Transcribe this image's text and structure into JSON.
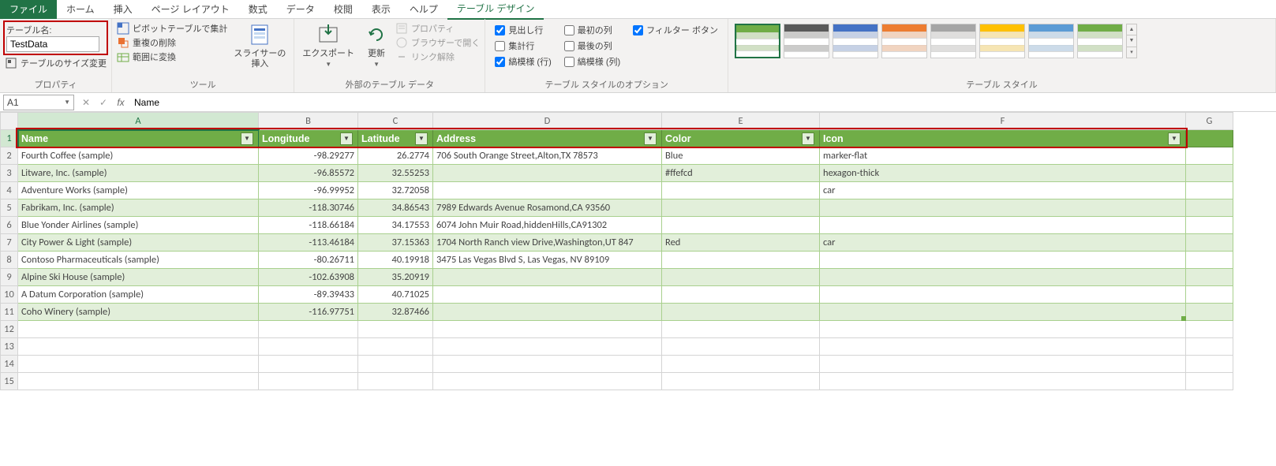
{
  "tabs": {
    "file": "ファイル",
    "home": "ホーム",
    "insert": "挿入",
    "pageLayout": "ページ レイアウト",
    "formulas": "数式",
    "data": "データ",
    "review": "校閲",
    "view": "表示",
    "help": "ヘルプ",
    "tableDesign": "テーブル デザイン"
  },
  "ribbon": {
    "props": {
      "label": "テーブル名:",
      "value": "TestData",
      "resize": "テーブルのサイズ変更",
      "group": "プロパティ"
    },
    "tools": {
      "pivot": "ピボットテーブルで集計",
      "dedup": "重複の削除",
      "range": "範囲に変換",
      "slicer": "スライサーの\n挿入",
      "group": "ツール"
    },
    "external": {
      "export": "エクスポート",
      "refresh": "更新",
      "properties": "プロパティ",
      "browser": "ブラウザーで開く",
      "unlink": "リンク解除",
      "group": "外部のテーブル データ"
    },
    "options": {
      "headerRow": "見出し行",
      "totalRow": "集計行",
      "bandedRows": "縞模様 (行)",
      "firstCol": "最初の列",
      "lastCol": "最後の列",
      "bandedCols": "縞模様 (列)",
      "filterBtn": "フィルター ボタン",
      "group": "テーブル スタイルのオプション"
    },
    "styles": {
      "group": "テーブル スタイル",
      "colors": [
        "#70ad47",
        "#595959",
        "#4472c4",
        "#ed7d31",
        "#a5a5a5",
        "#ffc000",
        "#5b9bd5",
        "#70ad47"
      ]
    }
  },
  "nameBox": "A1",
  "formula": "Name",
  "cols": [
    "A",
    "B",
    "C",
    "D",
    "E",
    "F",
    "G"
  ],
  "headers": [
    "Name",
    "Longitude",
    "Latitude",
    "Address",
    "Color",
    "Icon"
  ],
  "rows": [
    {
      "name": "Fourth Coffee (sample)",
      "lng": "-98.29277",
      "lat": "26.2774",
      "addr": "706 South Orange Street,Alton,TX 78573",
      "color": "Blue",
      "icon": "marker-flat"
    },
    {
      "name": "Litware, Inc. (sample)",
      "lng": "-96.85572",
      "lat": "32.55253",
      "addr": "",
      "color": "#ffefcd",
      "icon": "hexagon-thick"
    },
    {
      "name": "Adventure Works (sample)",
      "lng": "-96.99952",
      "lat": "32.72058",
      "addr": "",
      "color": "",
      "icon": "car"
    },
    {
      "name": "Fabrikam, Inc. (sample)",
      "lng": "-118.30746",
      "lat": "34.86543",
      "addr": "7989 Edwards Avenue Rosamond,CA 93560",
      "color": "",
      "icon": ""
    },
    {
      "name": "Blue Yonder Airlines (sample)",
      "lng": "-118.66184",
      "lat": "34.17553",
      "addr": "6074 John Muir Road,hiddenHills,CA91302",
      "color": "",
      "icon": ""
    },
    {
      "name": "City Power & Light (sample)",
      "lng": "-113.46184",
      "lat": "37.15363",
      "addr": "1704 North Ranch view Drive,Washington,UT 847",
      "color": "Red",
      "icon": "car"
    },
    {
      "name": "Contoso Pharmaceuticals (sample)",
      "lng": "-80.26711",
      "lat": "40.19918",
      "addr": "3475 Las Vegas Blvd S, Las Vegas, NV 89109",
      "color": "",
      "icon": ""
    },
    {
      "name": "Alpine Ski House (sample)",
      "lng": "-102.63908",
      "lat": "35.20919",
      "addr": "",
      "color": "",
      "icon": ""
    },
    {
      "name": "A Datum Corporation (sample)",
      "lng": "-89.39433",
      "lat": "40.71025",
      "addr": "",
      "color": "",
      "icon": ""
    },
    {
      "name": "Coho Winery (sample)",
      "lng": "-116.97751",
      "lat": "32.87466",
      "addr": "",
      "color": "",
      "icon": ""
    }
  ],
  "emptyRows": 4
}
